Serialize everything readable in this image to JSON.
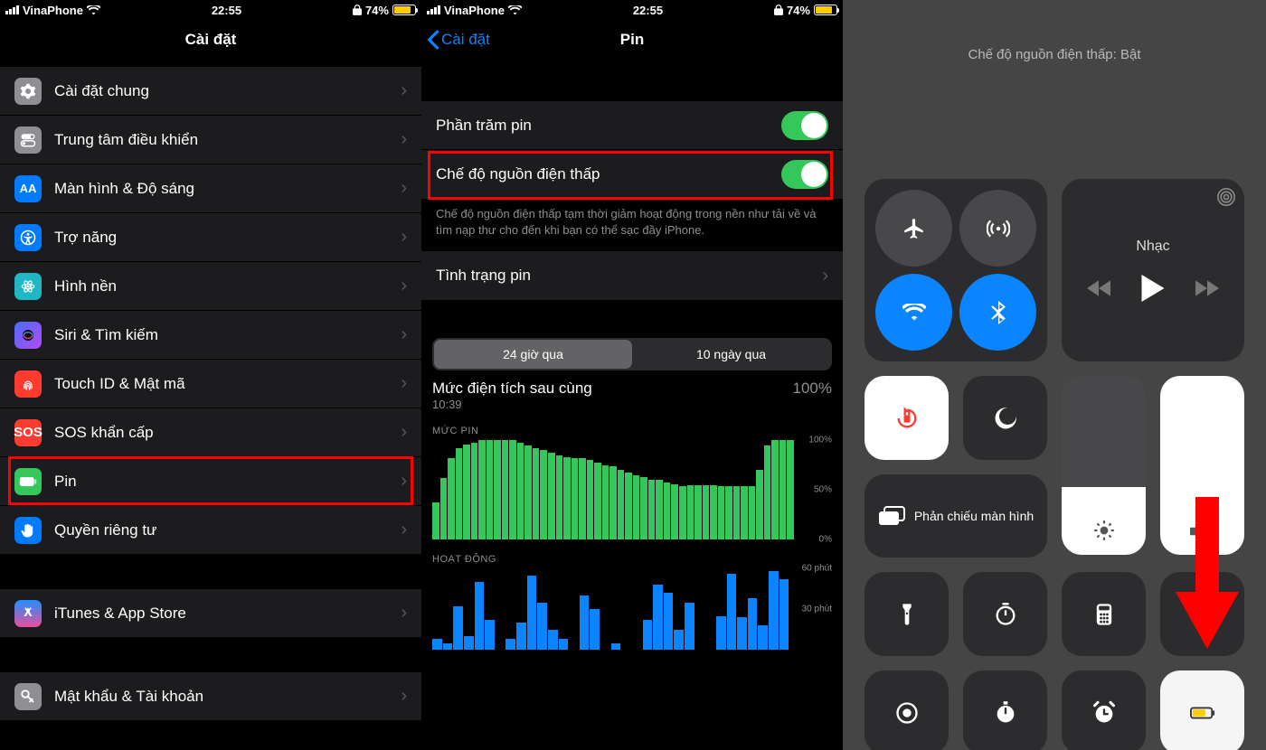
{
  "status": {
    "carrier": "VinaPhone",
    "time": "22:55",
    "battery_pct": "74%"
  },
  "p1": {
    "title": "Cài đặt",
    "items": [
      {
        "label": "Cài đặt chung"
      },
      {
        "label": "Trung tâm điều khiển"
      },
      {
        "label": "Màn hình & Độ sáng",
        "aa": "AA"
      },
      {
        "label": "Trợ năng"
      },
      {
        "label": "Hình nền"
      },
      {
        "label": "Siri & Tìm kiếm"
      },
      {
        "label": "Touch ID & Mật mã"
      },
      {
        "label": "SOS khẩn cấp",
        "sos": "SOS"
      },
      {
        "label": "Pin"
      },
      {
        "label": "Quyền riêng tư"
      }
    ],
    "itunes": "iTunes & App Store",
    "passwords": "Mật khẩu & Tài khoản"
  },
  "p2": {
    "back": "Cài đặt",
    "title": "Pin",
    "pct_label": "Phần trăm pin",
    "lpm_label": "Chế độ nguồn điện thấp",
    "lpm_desc": "Chế độ nguồn điện thấp tạm thời giảm hoạt động trong nền như tải về và tìm nạp thư cho đến khi bạn có thể sạc đầy iPhone.",
    "health": "Tình trạng pin",
    "seg24": "24 giờ qua",
    "seg10": "10 ngày qua",
    "lastcharge": "Mức điện tích sau cùng",
    "lasttime": "10:39",
    "lastpct": "100%",
    "lvl_header": "MỨC PIN",
    "act_header": "HOẠT ĐỘNG",
    "yl100": "100%",
    "yl50": "50%",
    "yl0": "0%",
    "ym60": "60 phút",
    "ym30": "30 phút"
  },
  "p3": {
    "toast": "Chế độ nguồn điện thấp: Bật",
    "music": "Nhạc",
    "mirror": "Phản chiếu màn hình"
  },
  "chart_data": [
    {
      "type": "bar",
      "title": "MỨC PIN",
      "ylim": [
        0,
        100
      ],
      "ylabel": "%",
      "values": [
        38,
        62,
        82,
        92,
        96,
        98,
        100,
        100,
        100,
        100,
        100,
        98,
        95,
        92,
        90,
        88,
        85,
        83,
        82,
        82,
        80,
        78,
        75,
        74,
        70,
        68,
        65,
        63,
        60,
        60,
        58,
        56,
        54,
        55,
        55,
        55,
        55,
        54,
        54,
        54,
        54,
        54,
        70,
        95,
        100,
        100,
        100
      ]
    },
    {
      "type": "bar",
      "title": "HOẠT ĐỘNG",
      "ylim": [
        0,
        60
      ],
      "ylabel": "phút",
      "values": [
        8,
        5,
        32,
        10,
        50,
        22,
        0,
        8,
        20,
        55,
        35,
        15,
        8,
        0,
        40,
        30,
        0,
        5,
        0,
        0,
        22,
        48,
        42,
        15,
        35,
        0,
        0,
        25,
        56,
        24,
        38,
        18,
        58,
        52
      ]
    }
  ]
}
